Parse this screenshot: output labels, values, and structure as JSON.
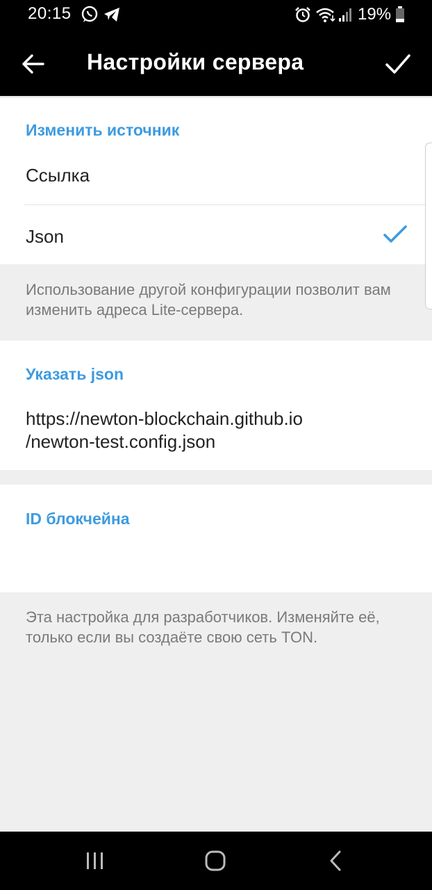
{
  "status_bar": {
    "time": "20:15",
    "battery": "19%",
    "icons": [
      "whatsapp-icon",
      "telegram-icon",
      "alarm-icon",
      "wifi-icon",
      "signal-icon",
      "battery-icon"
    ]
  },
  "app_bar": {
    "title": "Настройки сервера",
    "back_icon": "arrow-left-icon",
    "done_icon": "check-icon"
  },
  "source_section": {
    "header": "Изменить источник",
    "options": [
      {
        "label": "Ссылка",
        "selected": false
      },
      {
        "label": "Json",
        "selected": true
      }
    ],
    "hint": "Использование другой конфигурации позволит вам изменить адреса Lite-сервера."
  },
  "json_section": {
    "header": "Указать json",
    "value": "https://newton-blockchain.github.io/newton-test.config.json",
    "value_line1": "https://newton-blockchain.github.io",
    "value_line2": "/newton-test.config.json"
  },
  "blockchain_section": {
    "header": "ID блокчейна",
    "value": "",
    "hint": "Эта настройка для разработчиков. Изменяйте её, только если вы создаёте свою сеть TON."
  },
  "colors": {
    "accent": "#3d9be0",
    "bar_background": "#000000",
    "page_background": "#efefef"
  },
  "nav_bar": {
    "icons": [
      "recent-apps-icon",
      "home-icon",
      "back-icon"
    ]
  }
}
